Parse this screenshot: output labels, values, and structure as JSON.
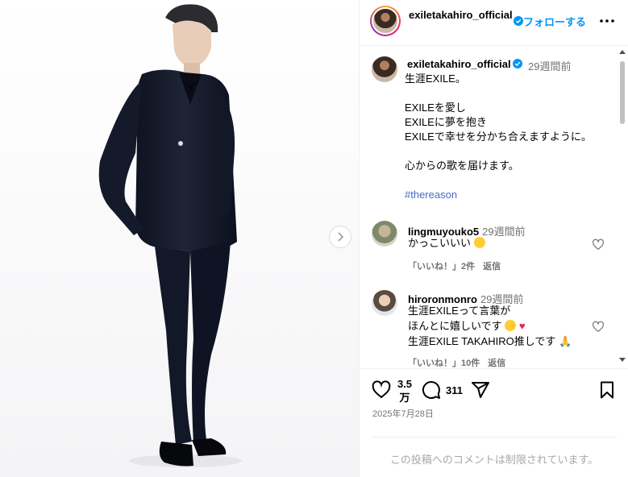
{
  "header": {
    "username": "exiletakahiro_official",
    "follow_label": "フォローする"
  },
  "caption": {
    "username": "exiletakahiro_official",
    "time": "29週間前",
    "lines": [
      "生涯EXILE。",
      "",
      "EXILEを愛し",
      "EXILEに夢を抱き",
      "EXILEで幸せを分かち合えますように。",
      "",
      "心からの歌を届けます。",
      ""
    ],
    "hashtag": "#thereason"
  },
  "comments": [
    {
      "username": "lingmuyouko5",
      "time": "29週間前",
      "lines": [
        "かっこいいい"
      ],
      "likes_label": "「いいね！」2件",
      "reply_label": "返信"
    },
    {
      "username": "hiroronmonro",
      "time": "29週間前",
      "lines": [
        "生涯EXILEって言葉が",
        "ほんとに嬉しいです",
        "生涯EXILE TAKAHIRO推しです"
      ],
      "likes_label": "「いいね！」10件",
      "reply_label": "返信"
    }
  ],
  "actions": {
    "like_count_line1": "3.5",
    "like_count_line2": "万",
    "comment_count": "311",
    "date": "2025年7月28日"
  },
  "footer": {
    "restricted_text": "この投稿へのコメントは制限されています。"
  },
  "colors": {
    "accent": "#0095f6",
    "hashtag": "#4d6cc1",
    "muted": "#737373"
  },
  "icons": [
    "chevron-right-icon",
    "verified-icon",
    "more-icon",
    "heart-icon",
    "comment-icon",
    "share-icon",
    "bookmark-icon"
  ]
}
